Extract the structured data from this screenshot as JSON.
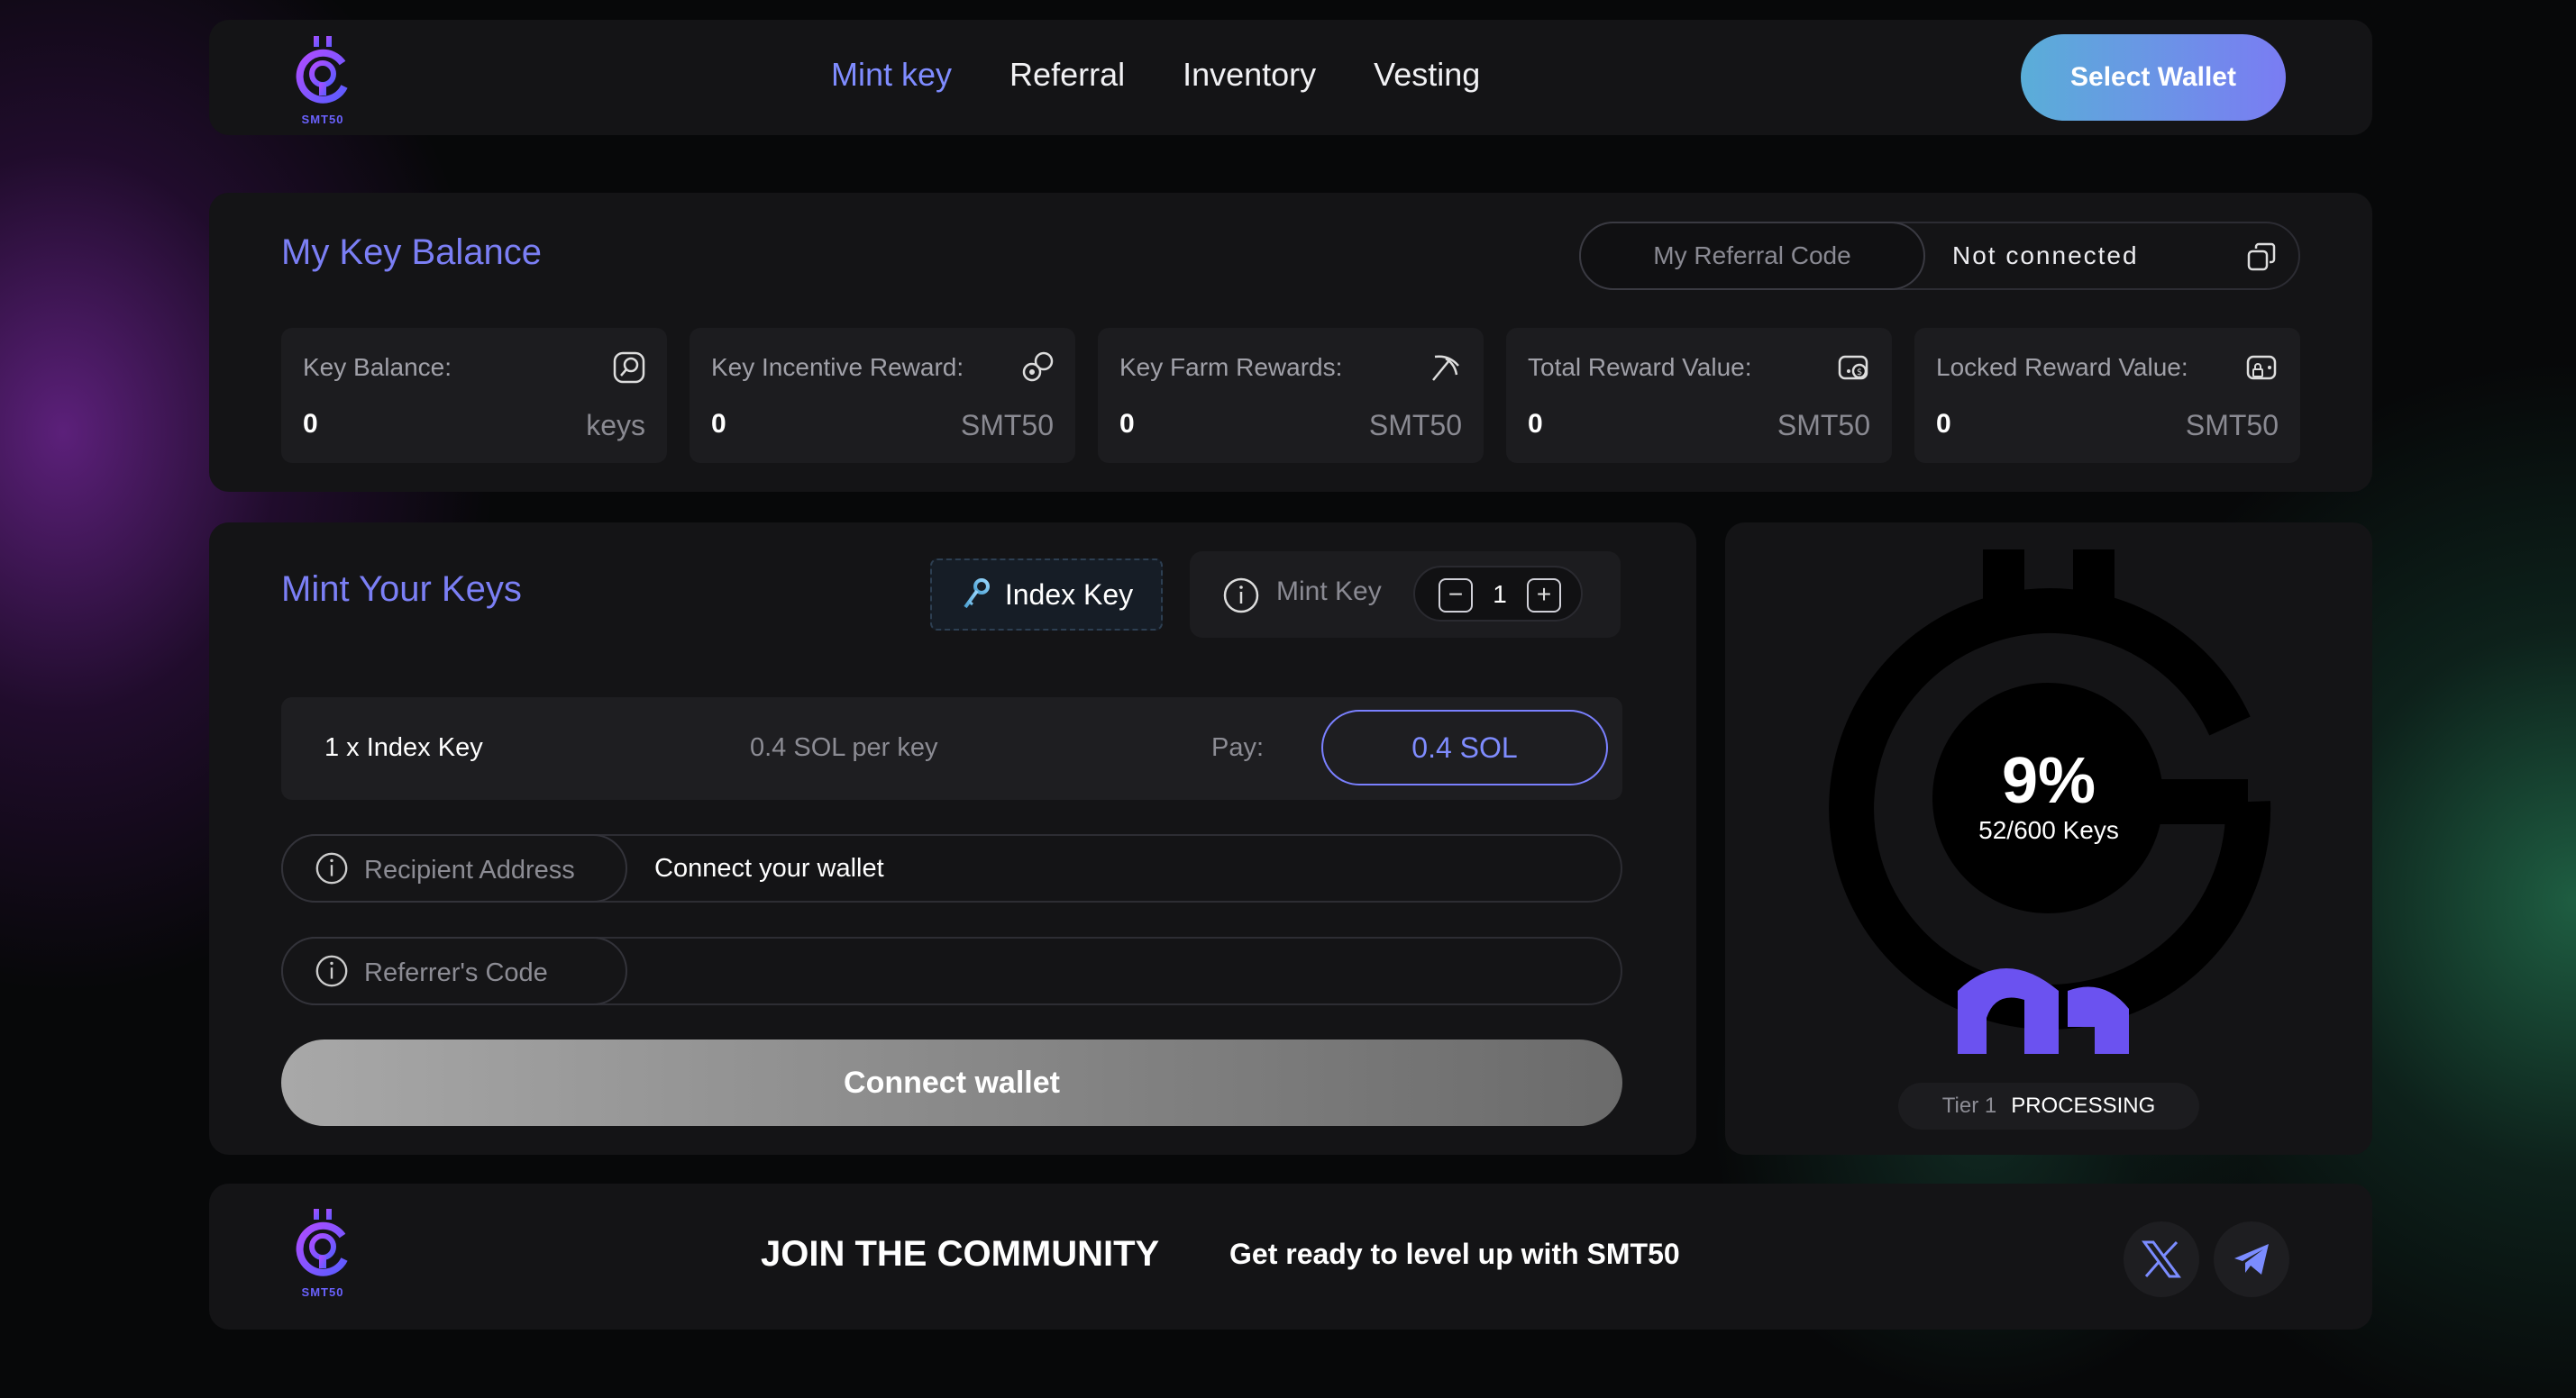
{
  "brand": {
    "logo_text": "SMT50",
    "color": "#6b62ff"
  },
  "nav": {
    "links": [
      "Mint key",
      "Referral",
      "Inventory",
      "Vesting"
    ],
    "active": "Mint key",
    "wallet_button": "Select Wallet"
  },
  "balance": {
    "title": "My Key Balance",
    "referral": {
      "label": "My Referral Code",
      "value": "Not connected",
      "icon": "copy-icon"
    },
    "stats": [
      {
        "label": "Key Balance:",
        "value": "0",
        "unit": "keys",
        "icon": "search-coin-icon"
      },
      {
        "label": "Key Incentive Reward:",
        "value": "0",
        "unit": "SMT50",
        "icon": "coins-icon"
      },
      {
        "label": "Key Farm Rewards:",
        "value": "0",
        "unit": "SMT50",
        "icon": "pickaxe-icon"
      },
      {
        "label": "Total Reward Value:",
        "value": "0",
        "unit": "SMT50",
        "icon": "wallet-dollar-icon"
      },
      {
        "label": "Locked Reward Value:",
        "value": "0",
        "unit": "SMT50",
        "icon": "wallet-lock-icon"
      }
    ]
  },
  "mint": {
    "title": "Mint Your Keys",
    "key_type": "Index Key",
    "mint_label": "Mint Key",
    "quantity": "1",
    "order": {
      "qty_text": "1 x Index Key",
      "price_text": "0.4 SOL per key",
      "pay_label": "Pay:",
      "pay_value": "0.4 SOL"
    },
    "recipient": {
      "label": "Recipient Address",
      "value": "Connect your wallet"
    },
    "referrer": {
      "label": "Referrer's Code",
      "value": ""
    },
    "connect_button": "Connect wallet"
  },
  "progress": {
    "percent": "9%",
    "keys": "52/600 Keys",
    "fraction": 0.09,
    "tier_label": "Tier 1",
    "tier_status": "PROCESSING"
  },
  "footer": {
    "title": "JOIN THE COMMUNITY",
    "subtitle": "Get ready to level up with SMT50",
    "socials": [
      "x-icon",
      "telegram-icon"
    ]
  }
}
